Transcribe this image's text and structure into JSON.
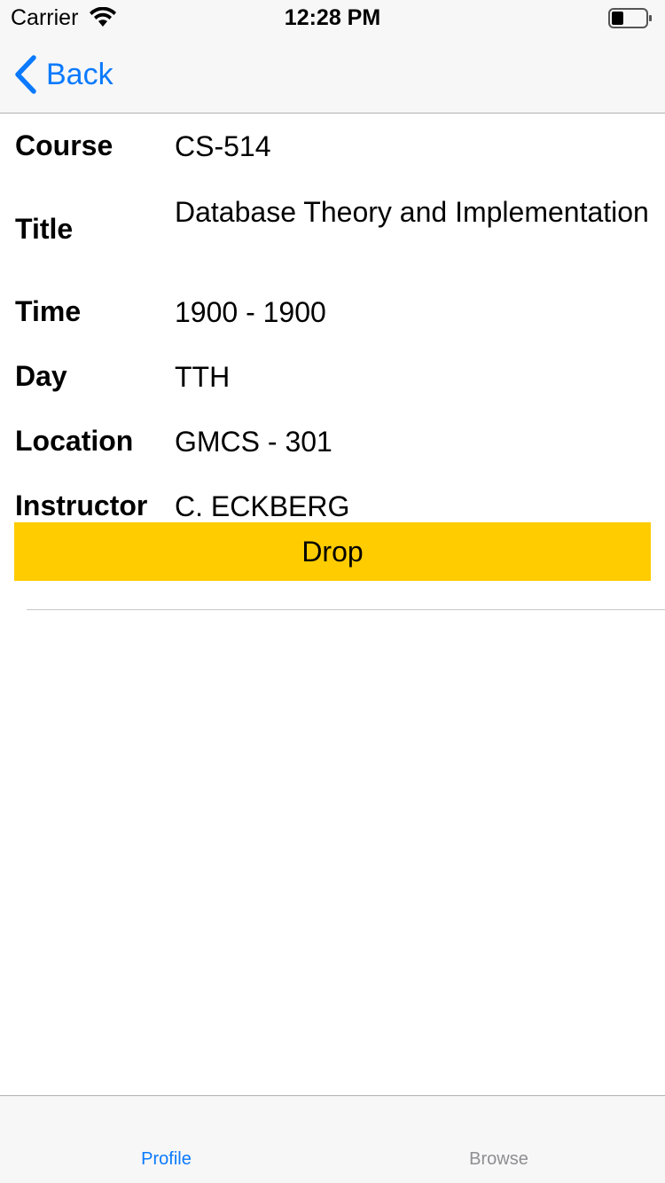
{
  "status_bar": {
    "carrier": "Carrier",
    "time": "12:28 PM",
    "battery_level": 0.35
  },
  "nav": {
    "back_label": "Back"
  },
  "course": {
    "rows": [
      {
        "label": "Course",
        "value": "CS-514"
      },
      {
        "label": "Title",
        "value": "Database Theory and Implementation"
      },
      {
        "label": "Time",
        "value": "1900 - 1900"
      },
      {
        "label": "Day",
        "value": "TTH"
      },
      {
        "label": "Location",
        "value": "GMCS - 301"
      },
      {
        "label": "Instructor",
        "value": "C. ECKBERG"
      }
    ]
  },
  "actions": {
    "drop_label": "Drop"
  },
  "tabs": [
    {
      "label": "Profile",
      "active": true
    },
    {
      "label": "Browse",
      "active": false
    }
  ],
  "colors": {
    "accent": "#0a7aff",
    "drop_button": "#ffcc00",
    "inactive_tab": "#8e8e93"
  }
}
